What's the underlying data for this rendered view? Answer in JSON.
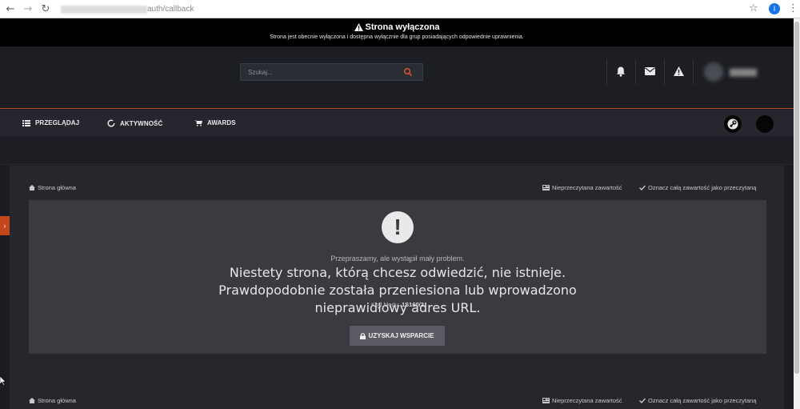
{
  "browser": {
    "back_icon": "←",
    "forward_icon": "→",
    "reload_icon": "↻",
    "url_visible": "auth/callback",
    "star_icon": "☆",
    "profile_letter": "I",
    "menu_icon": "⋮"
  },
  "offline": {
    "title": "Strona wyłączona",
    "description": "Strona jest obecnie wyłączona i dostępna wyłącznie dla grup posiadających odpowiednie uprawnienia."
  },
  "header": {
    "search_placeholder": "Szukaj..."
  },
  "nav": {
    "items": [
      {
        "label": "PRZEGLĄDAJ"
      },
      {
        "label": "AKTYWNOŚĆ"
      },
      {
        "label": "AWARDS"
      }
    ]
  },
  "breadcrumb": {
    "home": "Strona główna",
    "unread": "Nieprzeczytana zawartość",
    "mark_read": "Oznacz całą zawartość jako przeczytaną"
  },
  "error": {
    "subtitle": "Przepraszamy, ale wystąpił mały problem.",
    "message": "Niestety strona, którą chcesz odwiedzić, nie istnieje. Prawdopodobnie została przeniesiona lub wprowadzono nieprawidłowy adres URL.",
    "code_label": "Kod błędu:",
    "code_value": "1S160/2",
    "icon": "!",
    "button_label": "UZYSKAJ WSPARCIE"
  },
  "colors": {
    "accent": "#c1461c",
    "background": "#1b1c21",
    "panel": "#3a3b41"
  }
}
